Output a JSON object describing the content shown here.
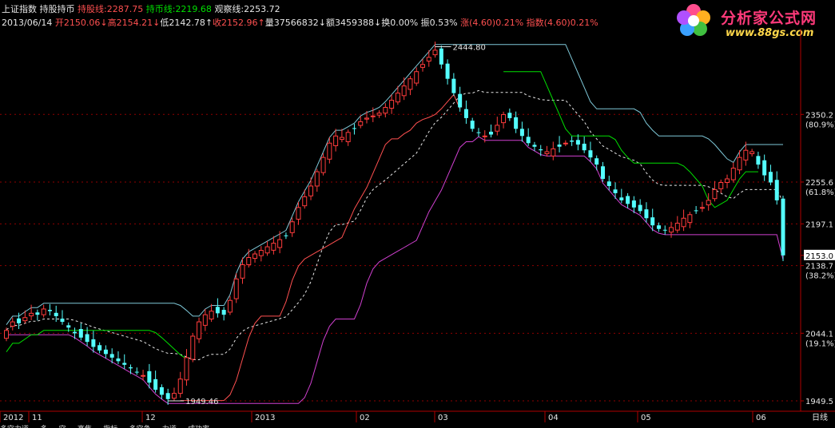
{
  "header": {
    "index_name": "上证指数",
    "indicator_name": "持股持币",
    "line1": {
      "label": "持股线:",
      "value": "2287.75",
      "color": "#ff5050"
    },
    "line2": {
      "label": "持币线:",
      "value": "2219.68",
      "color": "#00e000"
    },
    "line3": {
      "label": "观察线:",
      "value": "2253.72",
      "color": "#e6e6e6"
    },
    "date": "2013/06/14",
    "open": "开2150.06↓",
    "high": "高2154.21↓",
    "low": "低2142.78↑",
    "close": "收2152.96↑",
    "volume": "量37566832↓",
    "amount": "额3459388↓",
    "turnover": "换0.00%",
    "amplitude": "振0.53%",
    "change": "涨(4.60)0.21%",
    "index_change": "指数(4.60)0.21%"
  },
  "logo": {
    "title": "分析家公式网",
    "url": "www.88gs.com"
  },
  "chart_data": {
    "type": "candlestick",
    "x_labels": [
      "2012",
      "11",
      "12",
      "2013",
      "02",
      "03",
      "04",
      "05",
      "06"
    ],
    "period_label": "日线",
    "y_axis_labels": [
      {
        "value": "2350.2",
        "sub": "(80.9%)"
      },
      {
        "value": "2255.6",
        "sub": "(61.8%)"
      },
      {
        "value": "2197.1",
        "sub": ""
      },
      {
        "value": "2153.0",
        "sub": ""
      },
      {
        "value": "2138.7",
        "sub": "(38.2%)"
      },
      {
        "value": "2044.1",
        "sub": "(19.1%)"
      },
      {
        "value": "1949.5",
        "sub": ""
      }
    ],
    "annotations": [
      {
        "text": "2444.80",
        "value": 2444.8
      },
      {
        "text": "1949.46",
        "value": 1949.46
      }
    ],
    "ylim": [
      1935,
      2470
    ],
    "close": [
      2048,
      2060,
      2058,
      2066,
      2072,
      2070,
      2078,
      2075,
      2068,
      2060,
      2052,
      2044,
      2038,
      2032,
      2025,
      2020,
      2015,
      2010,
      2005,
      2000,
      1995,
      1990,
      1985,
      1975,
      1965,
      1958,
      1952,
      1960,
      1980,
      2010,
      2040,
      2060,
      2070,
      2075,
      2072,
      2070,
      2090,
      2120,
      2140,
      2150,
      2155,
      2160,
      2165,
      2170,
      2175,
      2180,
      2200,
      2220,
      2235,
      2250,
      2270,
      2290,
      2310,
      2320,
      2318,
      2325,
      2330,
      2340,
      2345,
      2348,
      2352,
      2360,
      2370,
      2380,
      2390,
      2400,
      2410,
      2420,
      2430,
      2440,
      2420,
      2400,
      2380,
      2360,
      2345,
      2330,
      2325,
      2320,
      2322,
      2335,
      2350,
      2345,
      2330,
      2320,
      2310,
      2305,
      2300,
      2298,
      2302,
      2305,
      2310,
      2312,
      2308,
      2300,
      2290,
      2280,
      2260,
      2250,
      2240,
      2230,
      2225,
      2220,
      2215,
      2205,
      2195,
      2190,
      2188,
      2192,
      2198,
      2205,
      2210,
      2215,
      2220,
      2230,
      2245,
      2255,
      2260,
      2275,
      2290,
      2300,
      2298,
      2280,
      2265,
      2255,
      2230,
      2153
    ],
    "series": [
      {
        "name": "持股线",
        "color": "#ff5050"
      },
      {
        "name": "持币线",
        "color": "#00e000"
      },
      {
        "name": "观察线",
        "color": "#e6e6e6"
      },
      {
        "name": "upper-band",
        "color": "#7ec8d8"
      },
      {
        "name": "lower-band",
        "color": "#d040d0"
      }
    ]
  },
  "bottom_text": "多空力道 ... 多 ... 空 ... 高焦 ... 指标 ... 多空争 ... 力道 ... 成功率 ..."
}
